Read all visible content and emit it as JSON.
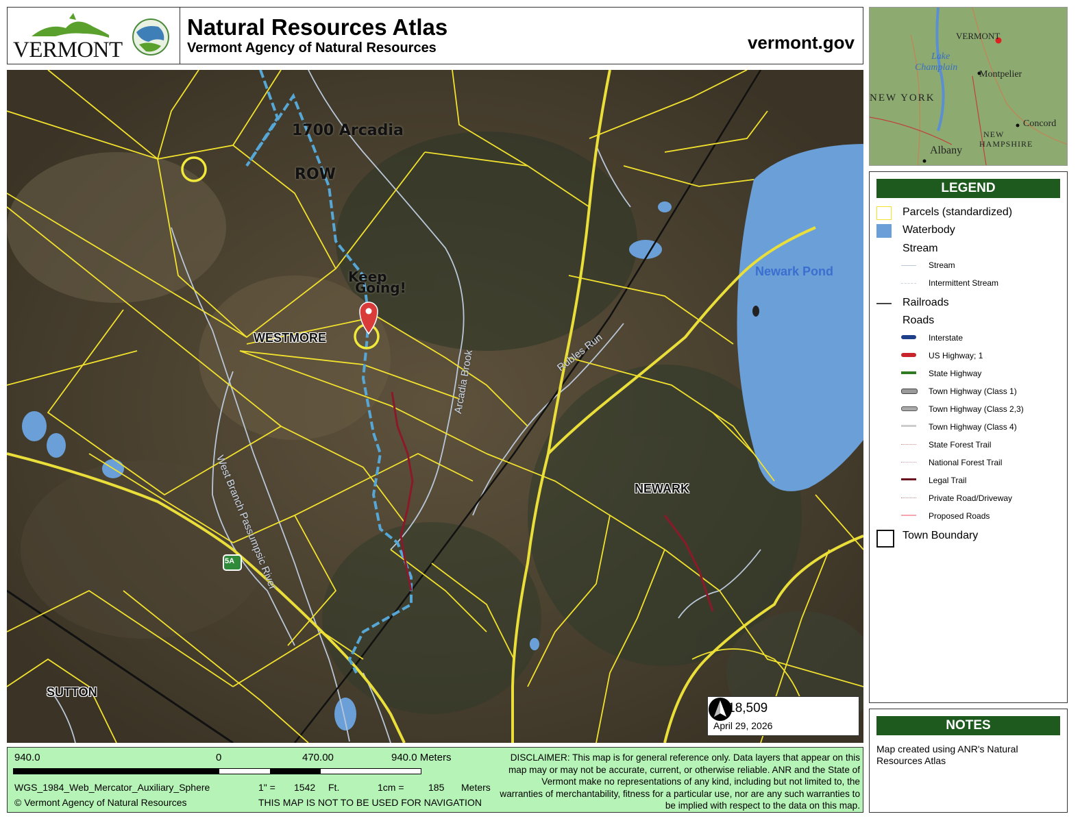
{
  "header": {
    "state_name": "VERMONT",
    "title": "Natural Resources Atlas",
    "subtitle": "Vermont Agency of Natural Resources",
    "site": "vermont.gov"
  },
  "map": {
    "annotations": {
      "line1": "1700 Arcadia",
      "line2": "ROW",
      "keep1": "Keep",
      "keep2": "Going!"
    },
    "towns": [
      "WESTMORE",
      "NEWARK",
      "SUTTON"
    ],
    "waterbody": "Newark Pond",
    "streams": [
      "West Branch Passumpsic River",
      "Arcadia Brook",
      "Rubles Run"
    ],
    "route_shield": "5A",
    "scale_ratio": "1:  18,509",
    "date": "April 29, 2026",
    "colors": {
      "parcel": "#f2e22e",
      "water": "#6a9fd8",
      "row_path": "#57a7d6",
      "legal_trail": "#8a1a2a"
    }
  },
  "inset": {
    "labels": [
      "VERMONT",
      "Lake",
      "Champlain",
      "Montpelier",
      "NEW YORK",
      "Concord",
      "NEW",
      "HAMPSHIRE",
      "Albany"
    ]
  },
  "legend": {
    "title": "LEGEND",
    "items": [
      {
        "label": "Parcels (standardized)",
        "level": "main"
      },
      {
        "label": "Waterbody",
        "level": "main"
      },
      {
        "label": "Stream",
        "level": "main"
      },
      {
        "label": "Stream",
        "level": "sub"
      },
      {
        "label": "Intermittent Stream",
        "level": "sub"
      },
      {
        "label": "Railroads",
        "level": "main"
      },
      {
        "label": "Roads",
        "level": "main"
      },
      {
        "label": "Interstate",
        "level": "sub"
      },
      {
        "label": "US Highway; 1",
        "level": "sub"
      },
      {
        "label": "State Highway",
        "level": "sub"
      },
      {
        "label": "Town Highway (Class 1)",
        "level": "sub"
      },
      {
        "label": "Town Highway (Class 2,3)",
        "level": "sub"
      },
      {
        "label": "Town Highway (Class 4)",
        "level": "sub"
      },
      {
        "label": "State Forest Trail",
        "level": "sub"
      },
      {
        "label": "National Forest Trail",
        "level": "sub"
      },
      {
        "label": "Legal Trail",
        "level": "sub"
      },
      {
        "label": "Private Road/Driveway",
        "level": "sub"
      },
      {
        "label": "Proposed Roads",
        "level": "sub"
      },
      {
        "label": "Town Boundary",
        "level": "main"
      }
    ]
  },
  "notes": {
    "title": "NOTES",
    "text": "Map created using ANR's Natural Resources Atlas"
  },
  "footer": {
    "scale_left": "940.0",
    "scale_zero": "0",
    "scale_mid": "470.00",
    "scale_right": "940.0 Meters",
    "projection": "WGS_1984_Web_Mercator_Auxiliary_Sphere",
    "inch_label": "1\" =",
    "inch_value": "1542",
    "inch_unit": "Ft.",
    "cm_label": "1cm =",
    "cm_value": "185",
    "cm_unit": "Meters",
    "copyright": "© Vermont Agency of Natural Resources",
    "nav_warning": "THIS MAP IS NOT TO BE USED FOR NAVIGATION",
    "disclaimer": "DISCLAIMER: This map is for general reference only. Data layers that appear on this map may or may not be accurate, current, or otherwise reliable. ANR and the State of Vermont make no representations of any kind, including but not limited to, the warranties of merchantability, fitness for a particular use, nor are any such warranties to be implied with respect to the data on this map."
  }
}
